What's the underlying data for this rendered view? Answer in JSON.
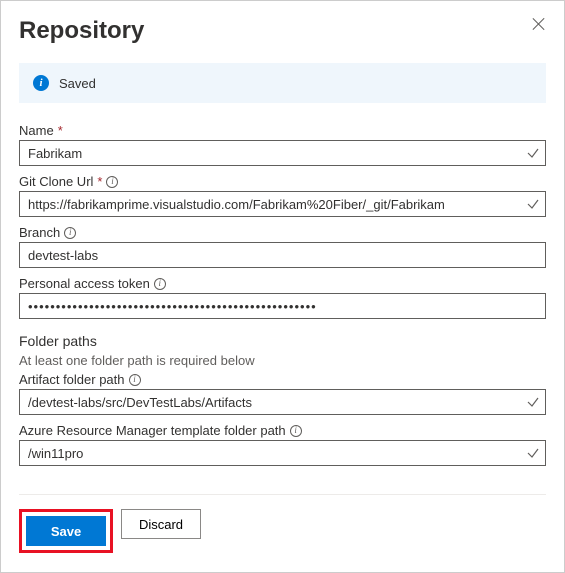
{
  "header": {
    "title": "Repository"
  },
  "banner": {
    "message": "Saved"
  },
  "fields": {
    "name": {
      "label": "Name",
      "value": "Fabrikam"
    },
    "cloneUrl": {
      "label": "Git Clone Url",
      "value": "https://fabrikamprime.visualstudio.com/Fabrikam%20Fiber/_git/Fabrikam"
    },
    "branch": {
      "label": "Branch",
      "value": "devtest-labs"
    },
    "pat": {
      "label": "Personal access token",
      "value": "••••••••••••••••••••••••••••••••••••••••••••••••••••"
    }
  },
  "folderPaths": {
    "title": "Folder paths",
    "hint": "At least one folder path is required below",
    "artifact": {
      "label": "Artifact folder path",
      "value": "/devtest-labs/src/DevTestLabs/Artifacts"
    },
    "arm": {
      "label": "Azure Resource Manager template folder path",
      "value": "/win11pro"
    }
  },
  "buttons": {
    "save": "Save",
    "discard": "Discard"
  }
}
